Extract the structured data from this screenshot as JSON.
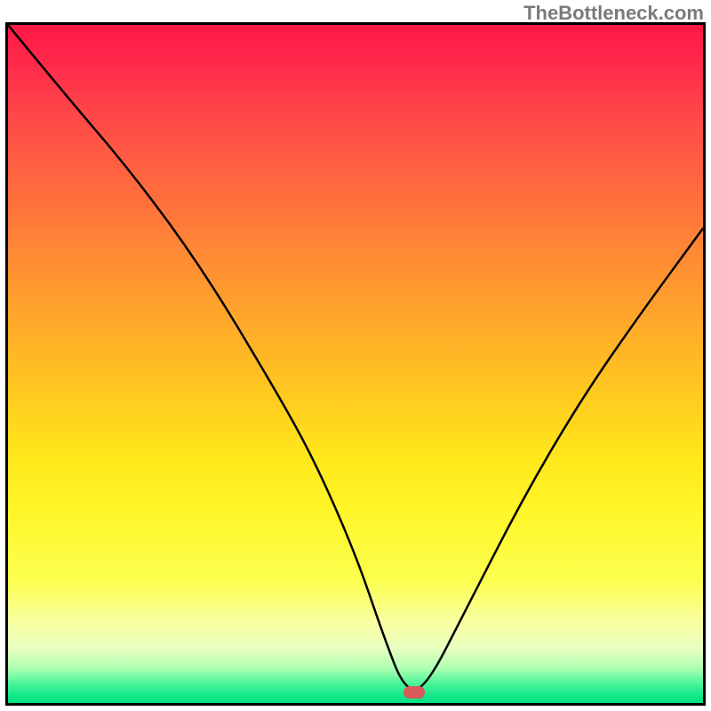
{
  "watermark": "TheBottleneck.com",
  "chart_data": {
    "type": "line",
    "title": "",
    "xlabel": "",
    "ylabel": "",
    "xlim": [
      0,
      100
    ],
    "ylim": [
      0,
      100
    ],
    "grid": false,
    "legend_position": "none",
    "series": [
      {
        "name": "bottleneck-curve",
        "x": [
          0,
          8,
          18,
          28,
          38,
          44,
          50,
          54,
          57,
          60,
          66,
          74,
          82,
          90,
          100
        ],
        "values": [
          100,
          90,
          78,
          64,
          47,
          36,
          22,
          10,
          2,
          2,
          14,
          30,
          44,
          56,
          70
        ]
      }
    ],
    "annotations": [
      {
        "name": "optimal-marker",
        "x": 58.5,
        "y": 1.6
      }
    ],
    "gradient_stops": [
      {
        "pos": 0,
        "color": "#ff1846"
      },
      {
        "pos": 50,
        "color": "#ffd020"
      },
      {
        "pos": 85,
        "color": "#fcff60"
      },
      {
        "pos": 100,
        "color": "#00e080"
      }
    ]
  }
}
